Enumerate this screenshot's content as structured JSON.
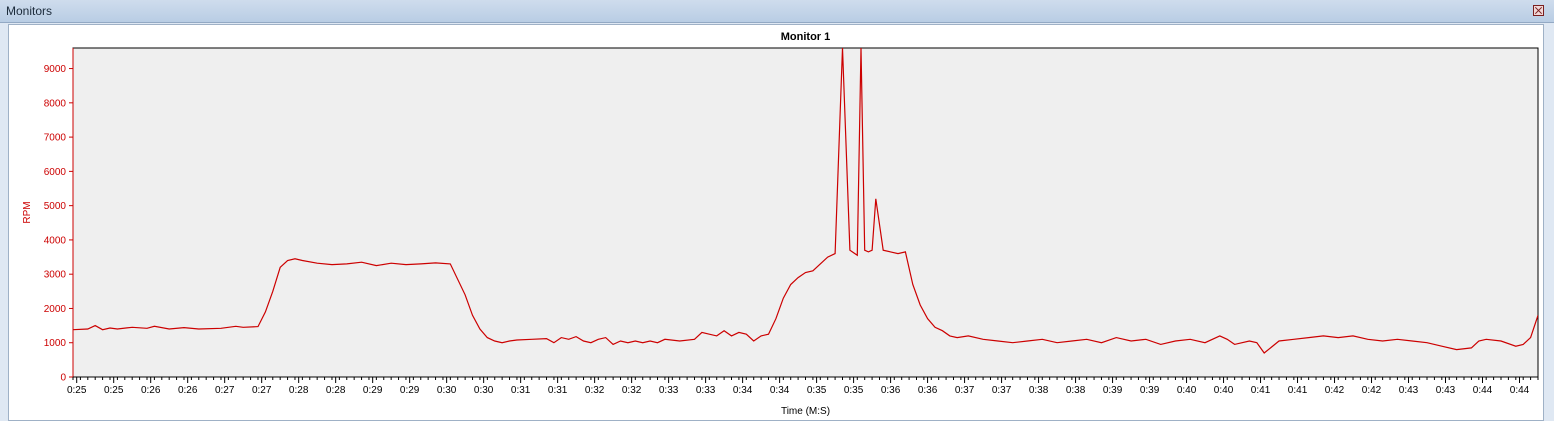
{
  "window": {
    "title": "Monitors",
    "close_label": "×"
  },
  "colors": {
    "series": "#cc0000",
    "plot_background": "#efefef",
    "axis": "#cc0000"
  },
  "chart_data": {
    "type": "line",
    "title": "Monitor 1",
    "xlabel": "Time (M:S)",
    "ylabel": "RPM",
    "ylim": [
      0,
      9600
    ],
    "xlim": [
      25,
      44.8
    ],
    "yticks": [
      0,
      1000,
      2000,
      3000,
      4000,
      5000,
      6000,
      7000,
      8000,
      9000
    ],
    "xtick_values": [
      25.05,
      25.55,
      26.05,
      26.55,
      27.05,
      27.55,
      28.05,
      28.55,
      29.05,
      29.55,
      30.05,
      30.55,
      31.05,
      31.55,
      32.05,
      32.55,
      33.05,
      33.55,
      34.05,
      34.55,
      35.05,
      35.55,
      36.05,
      36.55,
      37.05,
      37.55,
      38.05,
      38.55,
      39.05,
      39.55,
      40.05,
      40.55,
      41.05,
      41.55,
      42.05,
      42.55,
      43.05,
      43.55,
      44.05,
      44.55
    ],
    "xtick_labels": [
      "0:25",
      "0:25",
      "0:26",
      "0:26",
      "0:27",
      "0:27",
      "0:28",
      "0:28",
      "0:29",
      "0:29",
      "0:30",
      "0:30",
      "0:31",
      "0:31",
      "0:32",
      "0:32",
      "0:33",
      "0:33",
      "0:34",
      "0:34",
      "0:35",
      "0:35",
      "0:36",
      "0:36",
      "0:37",
      "0:37",
      "0:38",
      "0:38",
      "0:39",
      "0:39",
      "0:40",
      "0:40",
      "0:41",
      "0:41",
      "0:42",
      "0:42",
      "0:43",
      "0:43",
      "0:44",
      "0:44"
    ],
    "grid": false,
    "series": [
      {
        "x": [
          25,
          25.2,
          25.3,
          25.4,
          25.5,
          25.6,
          25.8,
          26,
          26.1,
          26.3,
          26.5,
          26.7,
          27,
          27.2,
          27.3,
          27.5,
          27.6,
          27.7,
          27.8,
          27.9,
          28,
          28.1,
          28.3,
          28.5,
          28.7,
          28.9,
          29.1,
          29.3,
          29.5,
          29.7,
          29.9,
          30.1,
          30.3,
          30.4,
          30.5,
          30.6,
          30.7,
          30.8,
          30.9,
          31,
          31.2,
          31.4,
          31.5,
          31.6,
          31.7,
          31.8,
          31.9,
          32,
          32.1,
          32.2,
          32.3,
          32.4,
          32.5,
          32.6,
          32.7,
          32.8,
          32.9,
          33,
          33.2,
          33.4,
          33.5,
          33.6,
          33.7,
          33.8,
          33.9,
          34,
          34.1,
          34.2,
          34.3,
          34.4,
          34.5,
          34.6,
          34.7,
          34.8,
          34.9,
          35,
          35.1,
          35.2,
          35.3,
          35.4,
          35.5,
          35.6,
          35.65,
          35.7,
          35.75,
          35.8,
          35.85,
          35.95,
          36.05,
          36.15,
          36.25,
          36.35,
          36.45,
          36.55,
          36.65,
          36.75,
          36.85,
          36.95,
          37.1,
          37.3,
          37.5,
          37.7,
          37.9,
          38.1,
          38.3,
          38.5,
          38.7,
          38.9,
          39.1,
          39.3,
          39.5,
          39.7,
          39.9,
          40.1,
          40.3,
          40.5,
          40.6,
          40.7,
          40.9,
          41,
          41.1,
          41.3,
          41.5,
          41.7,
          41.9,
          42.1,
          42.3,
          42.5,
          42.7,
          42.9,
          43.1,
          43.3,
          43.5,
          43.7,
          43.9,
          44,
          44.1,
          44.3,
          44.5,
          44.6,
          44.7,
          44.8
        ],
        "y": [
          1380,
          1400,
          1500,
          1380,
          1430,
          1400,
          1450,
          1420,
          1480,
          1400,
          1440,
          1400,
          1420,
          1480,
          1450,
          1470,
          1900,
          2500,
          3200,
          3400,
          3450,
          3400,
          3320,
          3280,
          3300,
          3350,
          3250,
          3320,
          3280,
          3300,
          3330,
          3300,
          2400,
          1800,
          1400,
          1150,
          1050,
          1000,
          1050,
          1080,
          1100,
          1120,
          1000,
          1150,
          1100,
          1180,
          1050,
          1000,
          1100,
          1150,
          950,
          1050,
          1000,
          1050,
          1000,
          1050,
          1000,
          1100,
          1050,
          1100,
          1300,
          1250,
          1200,
          1350,
          1200,
          1300,
          1250,
          1050,
          1200,
          1250,
          1700,
          2300,
          2700,
          2900,
          3050,
          3100,
          3300,
          3500,
          3600,
          9600,
          3700,
          3550,
          9600,
          3700,
          3650,
          3700,
          5200,
          3700,
          3650,
          3600,
          3650,
          2700,
          2100,
          1700,
          1450,
          1350,
          1200,
          1150,
          1200,
          1100,
          1050,
          1000,
          1050,
          1100,
          1000,
          1050,
          1100,
          1000,
          1150,
          1050,
          1100,
          950,
          1050,
          1100,
          1000,
          1200,
          1100,
          950,
          1050,
          1000,
          700,
          1050,
          1100,
          1150,
          1200,
          1150,
          1200,
          1100,
          1050,
          1100,
          1050,
          1000,
          900,
          800,
          850,
          1050,
          1100,
          1050,
          900,
          950,
          1150,
          1800
        ]
      }
    ]
  }
}
